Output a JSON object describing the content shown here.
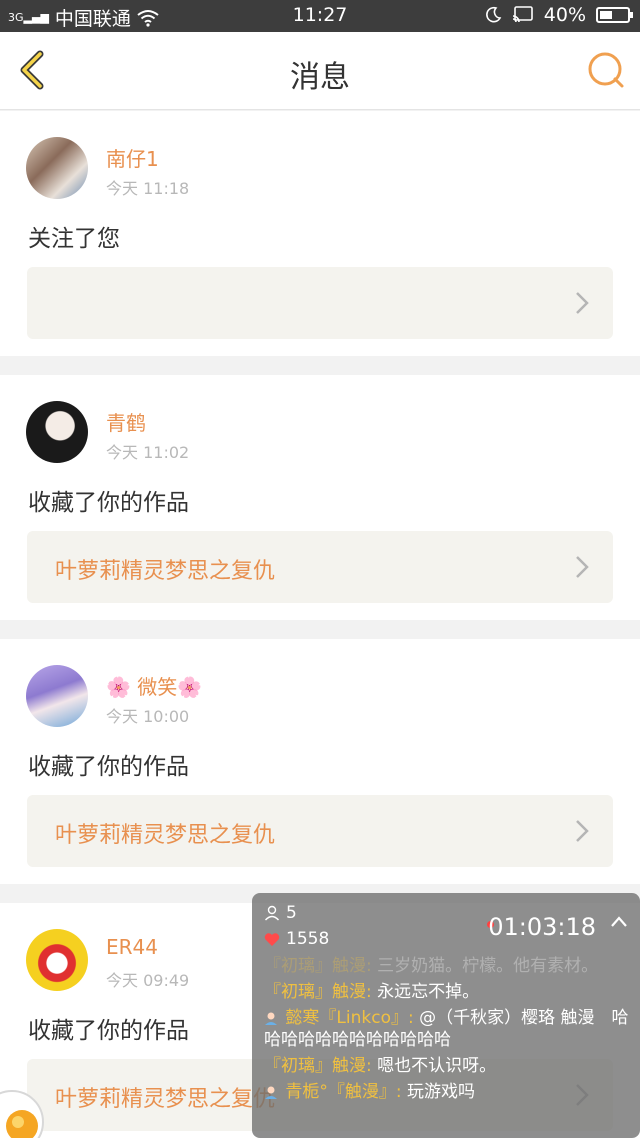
{
  "status_bar": {
    "network": "3G",
    "carrier": "中国联通",
    "time": "11:27",
    "battery": "40%",
    "battery_level": 0.4
  },
  "nav": {
    "title": "消息",
    "back_icon": "chevron-left-icon",
    "search_icon": "search-icon",
    "accent_color": "#f0a050"
  },
  "notifications": [
    {
      "username": "南仔1",
      "time": "今天 11:18",
      "action": "关注了您",
      "work_title": ""
    },
    {
      "username": "青鹤",
      "time": "今天 11:02",
      "action": "收藏了你的作品",
      "work_title": "叶萝莉精灵梦思之复仇"
    },
    {
      "username": "🌸 微笑🌸",
      "time": "今天 10:00",
      "action": "收藏了你的作品",
      "work_title": "叶萝莉精灵梦思之复仇"
    },
    {
      "username": "ER44",
      "time": "今天 09:49",
      "action": "收藏了你的作品",
      "work_title": "叶萝莉精灵梦思之复仇"
    }
  ],
  "live_panel": {
    "viewers": "5",
    "likes": "1558",
    "timer": "01:03:18",
    "chat": [
      {
        "name": "『初璃』触漫:",
        "text": "三岁奶猫。柠檬。他有素材。"
      },
      {
        "name": "『初璃』触漫:",
        "text": "永远忘不掉。"
      },
      {
        "name": "懿寒『Linkco』:",
        "text": "@（千秋家）樱珞 触漫　哈哈哈哈哈哈哈哈哈哈哈哈"
      },
      {
        "name": "『初璃』触漫:",
        "text": "嗯也不认识呀。"
      },
      {
        "name": "青栀°『触漫』:",
        "text": "玩游戏吗"
      }
    ]
  },
  "colors": {
    "accent": "#e8904f",
    "status_bar": "#3d3d3d"
  }
}
